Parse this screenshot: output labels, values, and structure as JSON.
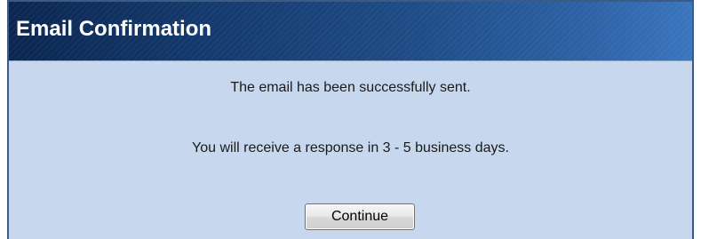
{
  "dialog": {
    "title": "Email Confirmation",
    "message_sent": "The email has been successfully sent.",
    "message_response": "You will receive a response in 3 - 5 business days.",
    "continue_label": "Continue"
  },
  "colors": {
    "titlebar_dark": "#0a2650",
    "titlebar_light": "#3a75bd",
    "panel_background": "#c7d8ee",
    "border": "#3c5a82"
  }
}
